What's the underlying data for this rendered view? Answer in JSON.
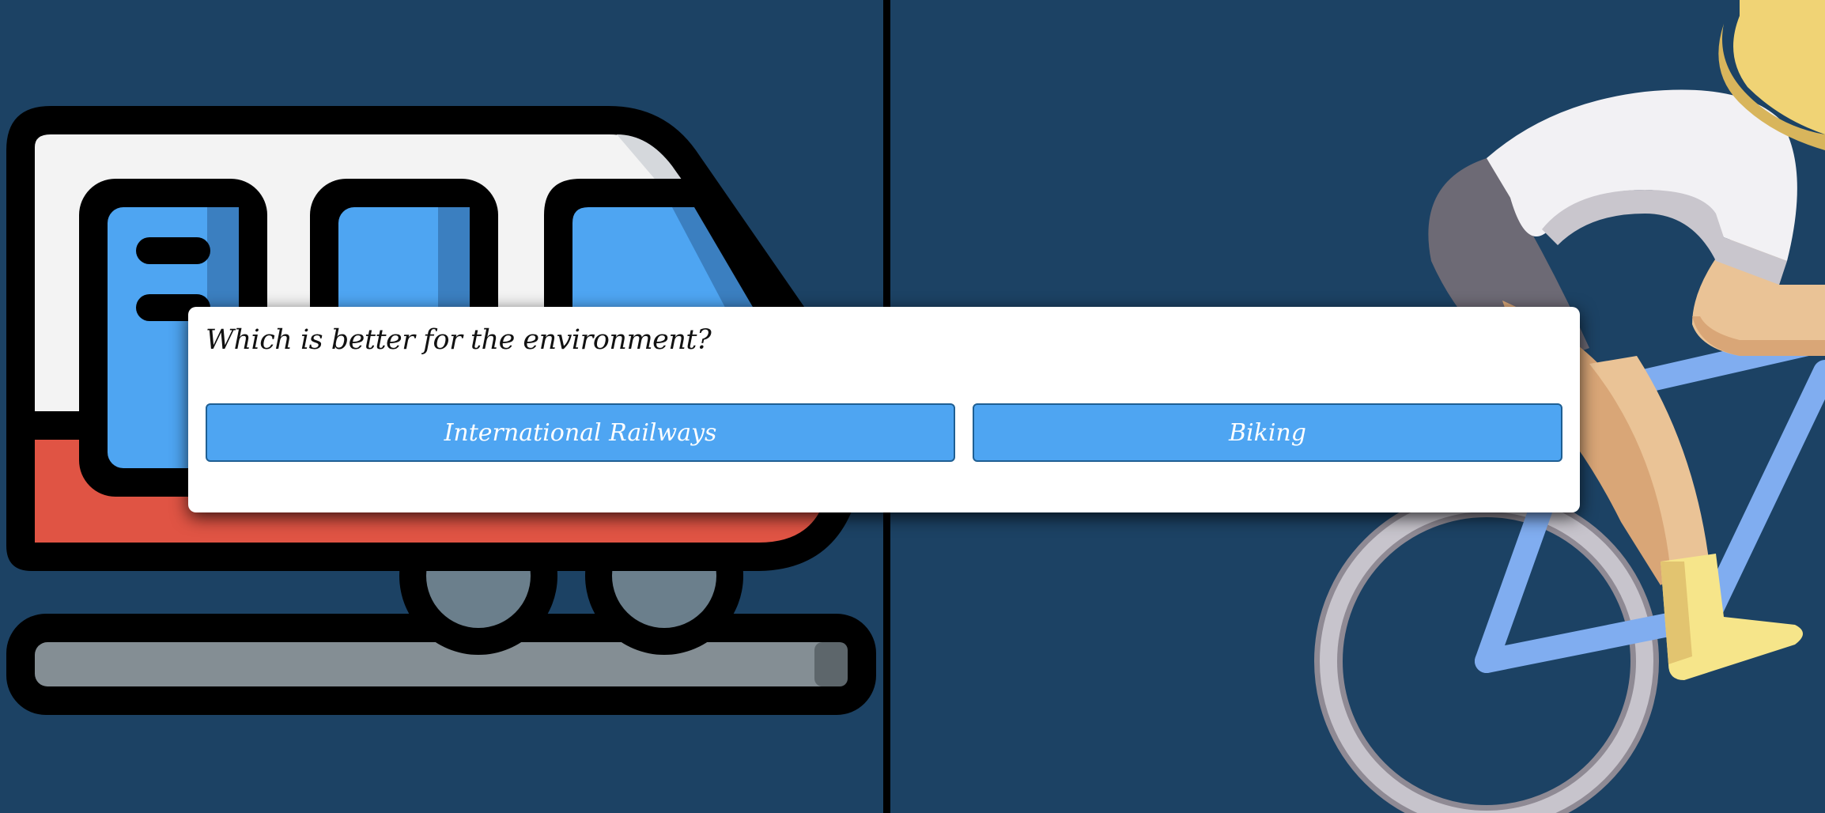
{
  "question": {
    "text": "Which is better for the environment?"
  },
  "options": [
    {
      "label": "International Railways",
      "icon": "train-icon"
    },
    {
      "label": "Biking",
      "icon": "cyclist-icon"
    }
  ],
  "colors": {
    "background": "#1c4264",
    "divider": "#000000",
    "button": "#4ea5f2",
    "button_border": "#1f5f93",
    "dialog": "#ffffff"
  }
}
